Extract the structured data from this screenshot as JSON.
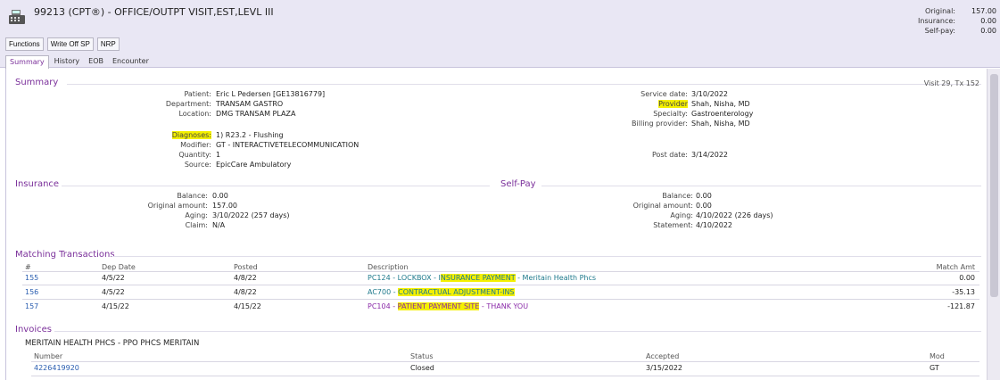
{
  "header": {
    "title": "99213 (CPT®) - OFFICE/OUTPT VISIT,EST,LEVL III",
    "totals": [
      {
        "label": "Original:",
        "value": "157.00"
      },
      {
        "label": "Insurance:",
        "value": "0.00"
      },
      {
        "label": "Self-pay:",
        "value": "0.00"
      }
    ]
  },
  "toolbar": {
    "functions": "Functions",
    "write_off": "Write Off SP",
    "nrp": "NRP"
  },
  "tabs": [
    "Summary",
    "History",
    "EOB",
    "Encounter"
  ],
  "summary": {
    "heading": "Summary",
    "visit": "Visit 29, Tx 152",
    "left": [
      {
        "k": "Patient:",
        "v": "Eric L Pedersen [GE13816779]"
      },
      {
        "k": "Department:",
        "v": "TRANSAM GASTRO"
      },
      {
        "k": "Location:",
        "v": "DMG TRANSAM PLAZA"
      },
      {
        "k": "Diagnoses:",
        "v": "1) R23.2 - Flushing"
      },
      {
        "k": "Modifier:",
        "v": "GT - INTERACTIVETELECOMMUNICATION"
      },
      {
        "k": "Quantity:",
        "v": "1"
      },
      {
        "k": "Source:",
        "v": "EpicCare Ambulatory"
      }
    ],
    "right": [
      {
        "k": "Service date:",
        "v": "3/10/2022"
      },
      {
        "k": "Provider",
        "v": "Shah, Nisha, MD"
      },
      {
        "k": "Specialty:",
        "v": "Gastroenterology"
      },
      {
        "k": "Billing provider:",
        "v": "Shah, Nisha, MD"
      },
      {
        "k": "Post date:",
        "v": "3/14/2022"
      }
    ]
  },
  "insurance": {
    "heading": "Insurance",
    "rows": [
      {
        "k": "Balance:",
        "v": "0.00"
      },
      {
        "k": "Original amount:",
        "v": "157.00"
      },
      {
        "k": "Aging:",
        "v": "3/10/2022 (257 days)"
      },
      {
        "k": "Claim:",
        "v": "N/A"
      }
    ]
  },
  "selfpay": {
    "heading": "Self-Pay",
    "rows": [
      {
        "k": "Balance:",
        "v": "0.00"
      },
      {
        "k": "Original amount:",
        "v": "0.00"
      },
      {
        "k": "Aging:",
        "v": "4/10/2022 (226 days)"
      },
      {
        "k": "Statement:",
        "v": "4/10/2022"
      }
    ]
  },
  "matching": {
    "heading": "Matching Transactions",
    "columns": [
      "#",
      "Dep Date",
      "Posted",
      "Description",
      "Match Amt"
    ],
    "rows": [
      {
        "id": "155",
        "dep": "4/5/22",
        "posted": "4/8/22",
        "code": "PC124",
        "sep1": " - LOCKBOX - I",
        "hl": "NSURANCE PAYMENT",
        "rest": " - Meritain Health Phcs",
        "amt": "0.00"
      },
      {
        "id": "156",
        "dep": "4/5/22",
        "posted": "4/8/22",
        "code": "AC700",
        "sep1": " - ",
        "hl": "CONTRACTUAL ADJUSTMENT-INS",
        "rest": "",
        "amt": "-35.13"
      },
      {
        "id": "157",
        "dep": "4/15/22",
        "posted": "4/15/22",
        "code": "PC104",
        "sep1": " - ",
        "hl": "PATIENT PAYMENT SITE",
        "rest": " - THANK YOU",
        "amt": "-121.87"
      }
    ]
  },
  "invoices": {
    "heading": "Invoices",
    "payer": "MERITAIN HEALTH PHCS - PPO PHCS MERITAIN",
    "columns": [
      "Number",
      "Status",
      "Accepted",
      "Mod"
    ],
    "rows": [
      {
        "number": "4226419920",
        "status": "Closed",
        "accepted": "3/15/2022",
        "mod": "GT"
      }
    ]
  },
  "icons": {
    "register": "cash-register-icon"
  },
  "colors": {
    "accent": "#7a2f9a",
    "link": "#2a5db0",
    "highlight": "#f4f000",
    "topbar": "#e9e7f4"
  }
}
